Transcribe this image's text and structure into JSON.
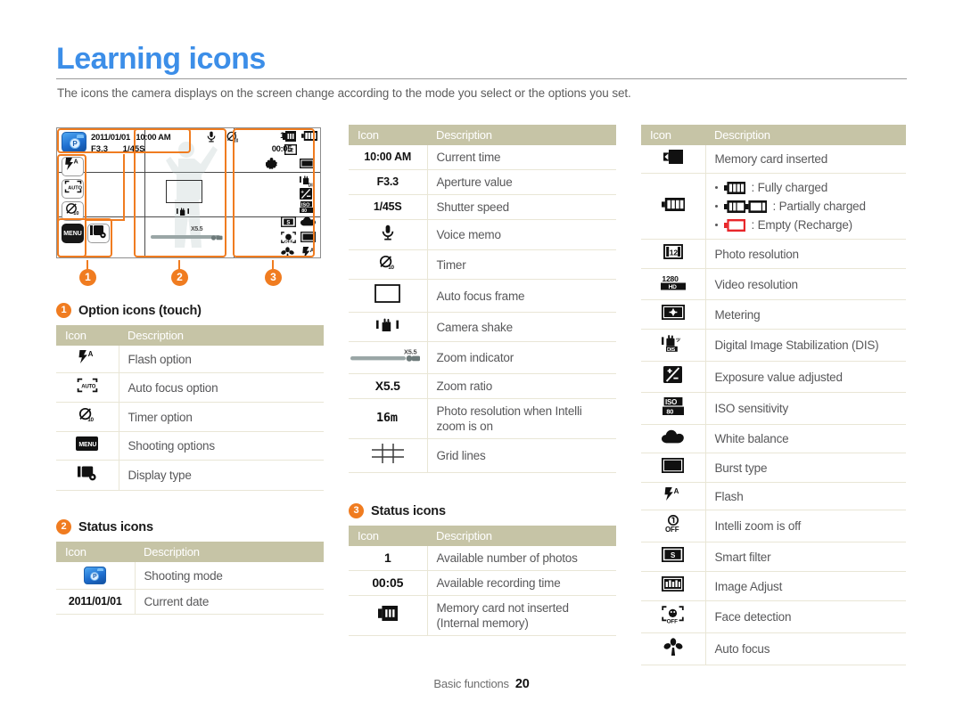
{
  "page": {
    "title": "Learning icons",
    "subtitle": "The icons the camera displays on the screen change according to the mode you select or the options you set.",
    "accent_color": "#f07c20",
    "title_color": "#3c8ee8",
    "table_header_bg": "#c6c4a6",
    "footer_label": "Basic functions",
    "footer_page": "20"
  },
  "screen_mock": {
    "mode_badge": "P",
    "date": "2011/01/01",
    "time": "10:00 AM",
    "aperture": "F3.3",
    "shutter": "1/45S",
    "zoom_label": "X5.5",
    "remaining_shots": "1",
    "recording_time": "00:05",
    "option_buttons": [
      "flash-auto",
      "af-auto",
      "timer-10s",
      "MENU",
      "display-type"
    ],
    "callouts": [
      "1",
      "2",
      "3"
    ]
  },
  "sections": {
    "option_icons": {
      "num": "1",
      "title": "Option icons (touch)",
      "header": {
        "icon": "Icon",
        "description": "Description"
      },
      "rows": [
        {
          "icon": "flash-auto-icon",
          "description": "Flash option"
        },
        {
          "icon": "auto-focus-option-icon",
          "description": "Auto focus option"
        },
        {
          "icon": "timer-option-icon",
          "description": "Timer option"
        },
        {
          "icon": "menu-icon",
          "description": "Shooting options"
        },
        {
          "icon": "display-type-icon",
          "description": "Display type"
        }
      ]
    },
    "status_icons_2": {
      "num": "2",
      "title": "Status icons",
      "header": {
        "icon": "Icon",
        "description": "Description"
      },
      "rows": [
        {
          "icon": "shooting-mode-p-icon",
          "text": "",
          "description": "Shooting mode"
        },
        {
          "icon": "text",
          "text": "2011/01/01",
          "description": "Current date"
        }
      ]
    },
    "middle_table": {
      "header": {
        "icon": "Icon",
        "description": "Description"
      },
      "rows": [
        {
          "icon": "text",
          "text": "10:00 AM",
          "description": "Current time"
        },
        {
          "icon": "text",
          "text": "F3.3",
          "description": "Aperture value"
        },
        {
          "icon": "text",
          "text": "1/45S",
          "description": "Shutter speed"
        },
        {
          "icon": "voice-memo-icon",
          "text": "",
          "description": "Voice memo"
        },
        {
          "icon": "timer-icon",
          "text": "",
          "description": "Timer"
        },
        {
          "icon": "auto-focus-frame-icon",
          "text": "",
          "description": "Auto focus frame"
        },
        {
          "icon": "camera-shake-icon",
          "text": "",
          "description": "Camera shake"
        },
        {
          "icon": "zoom-indicator-icon",
          "text": "",
          "description": "Zoom indicator"
        },
        {
          "icon": "text",
          "text": "X5.5",
          "description": "Zoom ratio"
        },
        {
          "icon": "resolution-16m-icon",
          "text": "16m",
          "description": "Photo resolution when Intelli zoom is on"
        },
        {
          "icon": "grid-lines-icon",
          "text": "",
          "description": "Grid lines"
        }
      ]
    },
    "status_icons_3": {
      "num": "3",
      "title": "Status icons",
      "header": {
        "icon": "Icon",
        "description": "Description"
      },
      "rows": [
        {
          "icon": "text",
          "text": "1",
          "description": "Available number of photos"
        },
        {
          "icon": "text",
          "text": "00:05",
          "description": "Available recording time"
        },
        {
          "icon": "memory-card-not-inserted-icon",
          "text": "",
          "description": "Memory card not inserted (Internal memory)"
        }
      ]
    },
    "right_table": {
      "header": {
        "icon": "Icon",
        "description": "Description"
      },
      "rows": [
        {
          "icon": "memory-card-inserted-icon",
          "description": "Memory card inserted"
        },
        {
          "icon": "battery-icon",
          "description": "",
          "battery": [
            {
              "label": ": Fully charged",
              "state": "full"
            },
            {
              "label": ": Partially charged",
              "state": "partial"
            },
            {
              "label": ": Empty (Recharge)",
              "state": "empty"
            }
          ]
        },
        {
          "icon": "photo-resolution-icon",
          "description": "Photo resolution"
        },
        {
          "icon": "video-resolution-icon",
          "description": "Video resolution",
          "badge_top": "1280",
          "badge_bottom": "HD"
        },
        {
          "icon": "metering-icon",
          "description": "Metering"
        },
        {
          "icon": "dis-icon",
          "description": "Digital Image Stabilization (DIS)"
        },
        {
          "icon": "exposure-value-icon",
          "description": "Exposure value adjusted"
        },
        {
          "icon": "iso-icon",
          "description": "ISO sensitivity"
        },
        {
          "icon": "white-balance-icon",
          "description": "White balance"
        },
        {
          "icon": "burst-type-icon",
          "description": "Burst type"
        },
        {
          "icon": "flash-icon",
          "description": "Flash"
        },
        {
          "icon": "intelli-zoom-off-icon",
          "description": "Intelli zoom is off"
        },
        {
          "icon": "smart-filter-icon",
          "description": "Smart filter"
        },
        {
          "icon": "image-adjust-icon",
          "description": "Image Adjust"
        },
        {
          "icon": "face-detection-off-icon",
          "description": "Face detection"
        },
        {
          "icon": "auto-focus-macro-icon",
          "description": "Auto focus"
        }
      ]
    }
  }
}
